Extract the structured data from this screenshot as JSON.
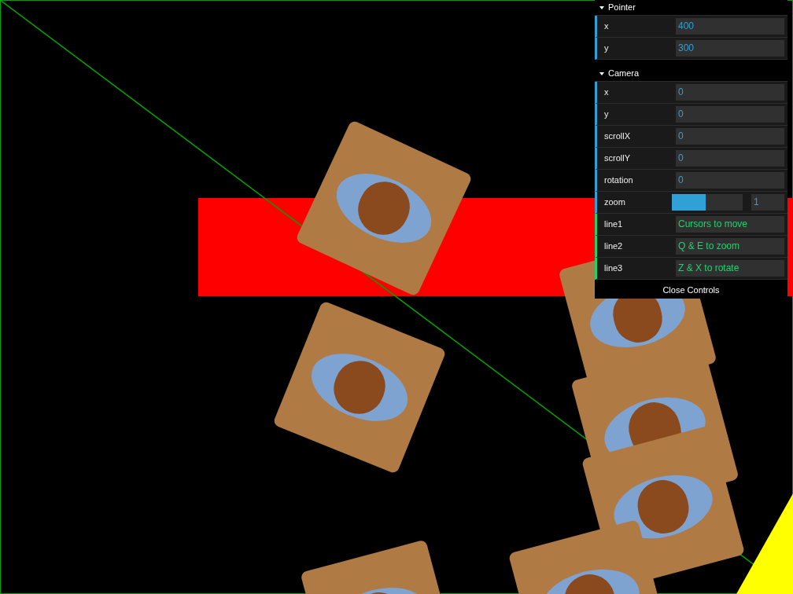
{
  "folders": [
    {
      "title": "Pointer",
      "expanded": true,
      "controls": [
        {
          "kind": "number",
          "label": "x",
          "value": "400"
        },
        {
          "kind": "number",
          "label": "y",
          "value": "300"
        }
      ]
    },
    {
      "title": "Camera",
      "expanded": true,
      "controls": [
        {
          "kind": "number",
          "label": "x",
          "value": "0"
        },
        {
          "kind": "number",
          "label": "y",
          "value": "0"
        },
        {
          "kind": "number",
          "label": "scrollX",
          "value": "0"
        },
        {
          "kind": "number",
          "label": "scrollY",
          "value": "0"
        },
        {
          "kind": "number",
          "label": "rotation",
          "value": "0"
        },
        {
          "kind": "slider",
          "label": "zoom",
          "level": 0.48,
          "value": "1"
        },
        {
          "kind": "string",
          "label": "line1",
          "value": "Cursors to move"
        },
        {
          "kind": "string",
          "label": "line2",
          "value": "Q & E to zoom"
        },
        {
          "kind": "string",
          "label": "line3",
          "value": "Z & X to rotate"
        }
      ]
    }
  ],
  "close_button": "Close Controls"
}
